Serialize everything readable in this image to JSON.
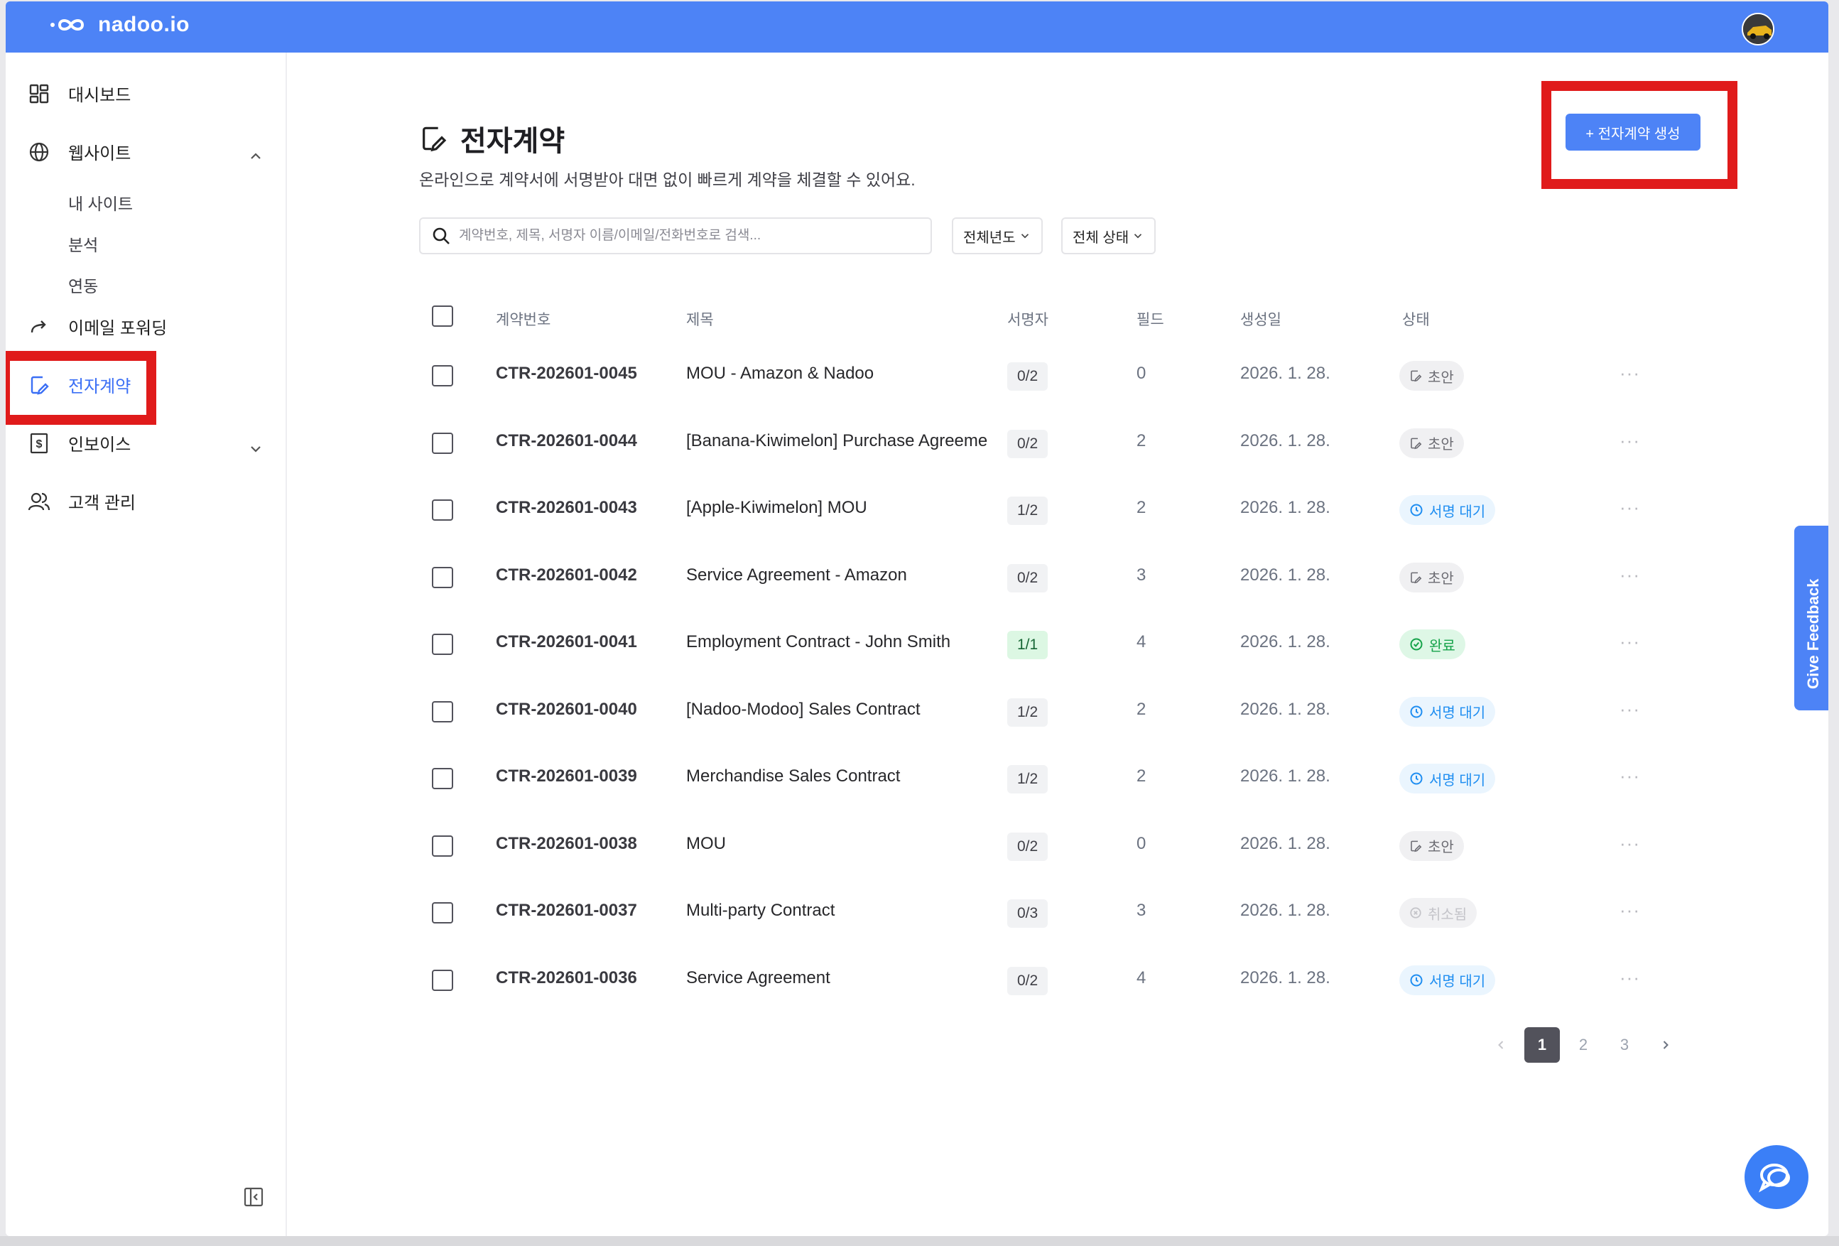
{
  "app": {
    "brand": "nadoo.io"
  },
  "sidebar": {
    "items": [
      {
        "label": "대시보드"
      },
      {
        "label": "웹사이트"
      },
      {
        "label": "이메일 포워딩"
      },
      {
        "label": "전자계약"
      },
      {
        "label": "인보이스"
      },
      {
        "label": "고객 관리"
      }
    ],
    "website_sub": [
      {
        "label": "내 사이트"
      },
      {
        "label": "분석"
      },
      {
        "label": "연동"
      }
    ]
  },
  "page": {
    "title": "전자계약",
    "subtitle": "온라인으로 계약서에 서명받아 대면 없이 빠르게 계약을 체결할 수 있어요.",
    "create_button": "+ 전자계약 생성"
  },
  "search": {
    "placeholder": "계약번호, 제목, 서명자 이름/이메일/전화번호로 검색..."
  },
  "filters": {
    "year": "전체년도",
    "status": "전체 상태"
  },
  "table": {
    "headers": {
      "id": "계약번호",
      "title": "제목",
      "signers": "서명자",
      "fields": "필드",
      "created": "생성일",
      "status": "상태"
    },
    "rows": [
      {
        "id": "CTR-202601-0045",
        "title": "MOU - Amazon & Nadoo",
        "signers": "0/2",
        "fields": "0",
        "date": "2026. 1. 28.",
        "status": "초안",
        "kind": "draft"
      },
      {
        "id": "CTR-202601-0044",
        "title": "[Banana-Kiwimelon] Purchase Agreement",
        "signers": "0/2",
        "fields": "2",
        "date": "2026. 1. 28.",
        "status": "초안",
        "kind": "draft"
      },
      {
        "id": "CTR-202601-0043",
        "title": "[Apple-Kiwimelon] MOU",
        "signers": "1/2",
        "fields": "2",
        "date": "2026. 1. 28.",
        "status": "서명 대기",
        "kind": "wait"
      },
      {
        "id": "CTR-202601-0042",
        "title": "Service Agreement - Amazon",
        "signers": "0/2",
        "fields": "3",
        "date": "2026. 1. 28.",
        "status": "초안",
        "kind": "draft"
      },
      {
        "id": "CTR-202601-0041",
        "title": "Employment Contract - John Smith",
        "signers": "1/1",
        "fields": "4",
        "date": "2026. 1. 28.",
        "status": "완료",
        "kind": "done"
      },
      {
        "id": "CTR-202601-0040",
        "title": "[Nadoo-Modoo] Sales Contract",
        "signers": "1/2",
        "fields": "2",
        "date": "2026. 1. 28.",
        "status": "서명 대기",
        "kind": "wait"
      },
      {
        "id": "CTR-202601-0039",
        "title": "Merchandise Sales Contract",
        "signers": "1/2",
        "fields": "2",
        "date": "2026. 1. 28.",
        "status": "서명 대기",
        "kind": "wait"
      },
      {
        "id": "CTR-202601-0038",
        "title": "MOU",
        "signers": "0/2",
        "fields": "0",
        "date": "2026. 1. 28.",
        "status": "초안",
        "kind": "draft"
      },
      {
        "id": "CTR-202601-0037",
        "title": "Multi-party Contract",
        "signers": "0/3",
        "fields": "3",
        "date": "2026. 1. 28.",
        "status": "취소됨",
        "kind": "cancel"
      },
      {
        "id": "CTR-202601-0036",
        "title": "Service Agreement",
        "signers": "0/2",
        "fields": "4",
        "date": "2026. 1. 28.",
        "status": "서명 대기",
        "kind": "wait"
      }
    ]
  },
  "pagination": {
    "pages": [
      "1",
      "2",
      "3"
    ],
    "current": "1"
  },
  "feedback": {
    "label": "Give Feedback"
  },
  "colors": {
    "brand": "#4d83f6",
    "highlight": "#e01b1b",
    "wait": "#1f8ef1",
    "done": "#16a34a"
  }
}
